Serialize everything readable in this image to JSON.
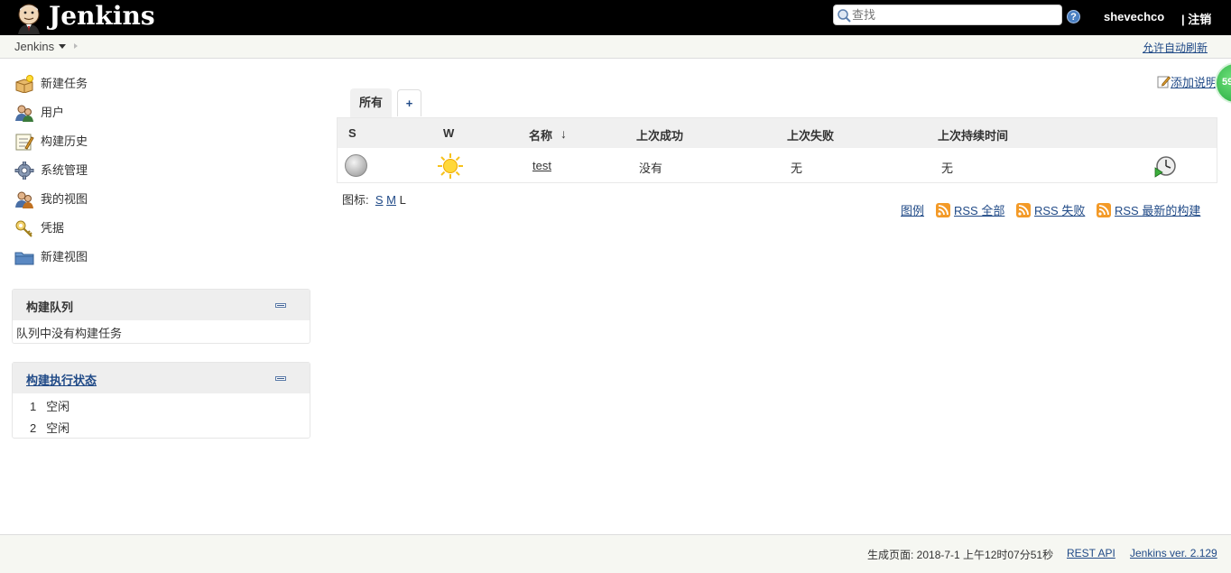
{
  "header": {
    "brand": "Jenkins",
    "search_placeholder": "查找",
    "help": "?",
    "user": "shevechco",
    "logout": "| 注销"
  },
  "breadcrumb": {
    "root": "Jenkins",
    "auto_refresh": "允许自动刷新"
  },
  "sidebar": {
    "tasks": [
      {
        "label": "新建任务",
        "icon": "new-item-icon"
      },
      {
        "label": "用户",
        "icon": "users-icon"
      },
      {
        "label": "构建历史",
        "icon": "build-history-icon"
      },
      {
        "label": "系统管理",
        "icon": "gear-icon"
      },
      {
        "label": "我的视图",
        "icon": "my-views-icon"
      },
      {
        "label": "凭据",
        "icon": "credentials-icon"
      },
      {
        "label": "新建视图",
        "icon": "new-view-icon"
      }
    ],
    "queue": {
      "title": "构建队列",
      "empty": "队列中没有构建任务"
    },
    "executors": {
      "title": "构建执行状态",
      "rows": [
        {
          "num": "1",
          "status": "空闲"
        },
        {
          "num": "2",
          "status": "空闲"
        }
      ]
    }
  },
  "main": {
    "add_description": "添加说明",
    "badge": "59",
    "tabs": [
      {
        "label": "所有",
        "active": true
      },
      {
        "label": "+",
        "active": false
      }
    ],
    "table": {
      "columns": [
        "S",
        "W",
        "名称",
        "上次成功",
        "上次失败",
        "上次持续时间"
      ],
      "sort_indicator": "↓",
      "rows": [
        {
          "status_icon": "grey-ball-icon",
          "weather_icon": "sunny-icon",
          "name": "test",
          "last_success": "没有",
          "last_failure": "无",
          "last_duration": "无",
          "action_icon": "schedule-build-icon"
        }
      ]
    },
    "icon_size": {
      "label": "图标:",
      "sizes": [
        "S",
        "M",
        "L"
      ]
    },
    "legend": "图例",
    "feeds": [
      "RSS 全部",
      "RSS 失败",
      "RSS 最新的构建"
    ]
  },
  "footer": {
    "generated": "生成页面: 2018-7-1 上午12时07分51秒",
    "rest_api": "REST API",
    "version": "Jenkins ver. 2.129"
  },
  "colors": {
    "header_bg": "#000000",
    "link": "#204a87",
    "bar_bg": "#f6f7f2",
    "rss": "#f39a28",
    "badge": "#2db34a"
  }
}
